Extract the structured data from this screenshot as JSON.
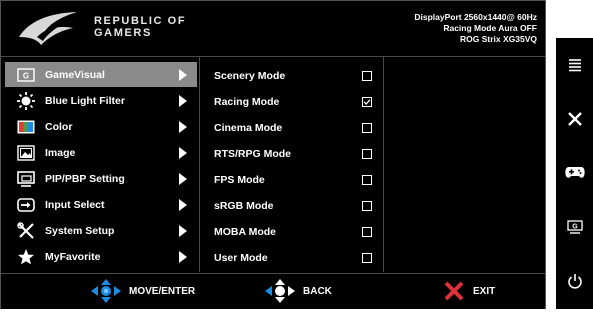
{
  "header": {
    "brand_line1": "REPUBLIC OF",
    "brand_line2": "GAMERS",
    "status_line1": "DisplayPort 2560x1440@ 60Hz",
    "status_line2": "Racing Mode Aura OFF",
    "status_line3": "ROG Strix XG35VQ"
  },
  "menu": {
    "items": [
      {
        "label": "GameVisual",
        "icon": "gamevisual-icon",
        "selected": true
      },
      {
        "label": "Blue Light Filter",
        "icon": "blue-light-icon"
      },
      {
        "label": "Color",
        "icon": "color-icon"
      },
      {
        "label": "Image",
        "icon": "image-icon"
      },
      {
        "label": "PIP/PBP Setting",
        "icon": "pip-icon"
      },
      {
        "label": "Input Select",
        "icon": "input-select-icon"
      },
      {
        "label": "System Setup",
        "icon": "system-setup-icon"
      },
      {
        "label": "MyFavorite",
        "icon": "star-icon"
      }
    ]
  },
  "submenu": {
    "items": [
      {
        "label": "Scenery Mode",
        "checked": false
      },
      {
        "label": "Racing Mode",
        "checked": true
      },
      {
        "label": "Cinema Mode",
        "checked": false
      },
      {
        "label": "RTS/RPG Mode",
        "checked": false
      },
      {
        "label": "FPS Mode",
        "checked": false
      },
      {
        "label": "sRGB Mode",
        "checked": false
      },
      {
        "label": "MOBA Mode",
        "checked": false
      },
      {
        "label": "User Mode",
        "checked": false
      }
    ]
  },
  "footer": {
    "move_label": "MOVE/ENTER",
    "back_label": "BACK",
    "exit_label": "EXIT"
  },
  "side_buttons": [
    "menu-icon",
    "close-icon",
    "gamepad-icon",
    "gamevisual-icon",
    "power-icon"
  ],
  "colors": {
    "selected_bg": "#8a8a8a",
    "arrow_blue": "#1a8be0",
    "exit_red": "#e0303a"
  }
}
